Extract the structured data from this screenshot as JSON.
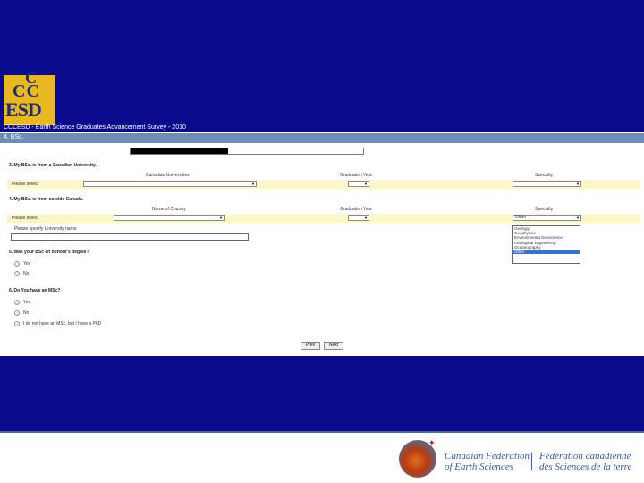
{
  "branding": {
    "logo_line1": "C",
    "logo_line2": "CC",
    "logo_line3": "ESD",
    "survey_title": "CCCESD - Earth Science Graduates Advancement Survey - 2010"
  },
  "section": {
    "label": "4. BSc."
  },
  "progress": {
    "fraction": 0.42
  },
  "q3": {
    "label": "3. My BSc. is from a Canadian University.",
    "col_university": "Canadian Universities",
    "col_year": "Graduation Year",
    "col_specialty": "Specialty",
    "select_placeholder": "Please select"
  },
  "q4": {
    "label": "4. My BSc. is from outside Canada.",
    "col_country": "Name of Country",
    "col_year": "Graduation Year",
    "col_specialty": "Specialty",
    "select_placeholder": "Please select",
    "specialty_value": "Other",
    "specify_label": "Please specify University name"
  },
  "specialty_options": [
    "Geology",
    "Geophysics",
    "Environmental Geoscience",
    "Geological Engineering",
    "Oceanography",
    "Other"
  ],
  "q5": {
    "label": "5. Was your BSc an honour's degree?",
    "options": [
      "Yes",
      "No"
    ]
  },
  "q6": {
    "label": "6. Do You have an MSc?",
    "options": [
      "Yes",
      "No",
      "I do not have an MSc, but I have a PhD"
    ]
  },
  "nav": {
    "prev": "Prev",
    "next": "Next"
  },
  "footer": {
    "en_line1": "Canadian Federation",
    "en_line2": "of Earth Sciences",
    "fr_line1": "Fédération canadienne",
    "fr_line2": "des Sciences de la terre"
  },
  "colors": {
    "band": "#0a0a8c",
    "section_bar": "#6b8db8",
    "highlight_row": "#fdf6c6",
    "logo_bg": "#e8b820"
  }
}
